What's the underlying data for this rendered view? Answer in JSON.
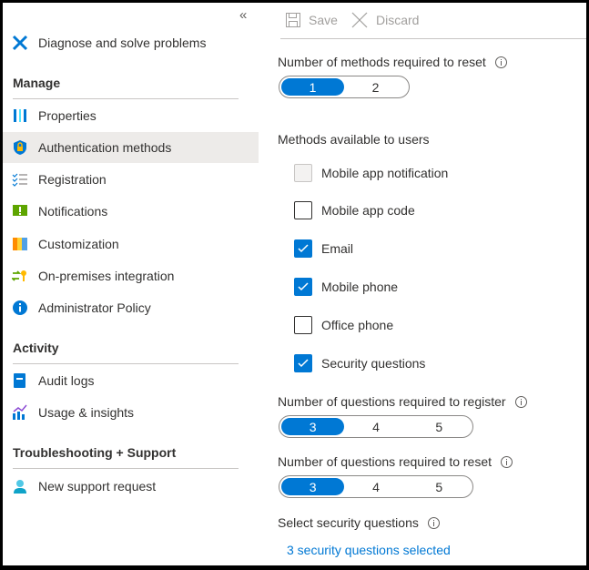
{
  "sidebar": {
    "collapse_icon": "double-chevron-left",
    "diagnose": "Diagnose and solve problems",
    "sections": {
      "manage": "Manage",
      "activity": "Activity",
      "troubleshooting": "Troubleshooting + Support"
    },
    "items": [
      {
        "label": "Properties",
        "icon": "properties-icon"
      },
      {
        "label": "Authentication methods",
        "icon": "shield-lock-icon"
      },
      {
        "label": "Registration",
        "icon": "checklist-icon"
      },
      {
        "label": "Notifications",
        "icon": "notification-icon"
      },
      {
        "label": "Customization",
        "icon": "customization-icon"
      },
      {
        "label": "On-premises integration",
        "icon": "sync-key-icon"
      },
      {
        "label": "Administrator Policy",
        "icon": "info-icon"
      },
      {
        "label": "Audit logs",
        "icon": "book-icon"
      },
      {
        "label": "Usage & insights",
        "icon": "chart-icon"
      },
      {
        "label": "New support request",
        "icon": "support-person-icon"
      }
    ]
  },
  "toolbar": {
    "save": "Save",
    "discard": "Discard"
  },
  "main": {
    "methods_reset_label": "Number of methods required to reset",
    "methods_reset_options": [
      "1",
      "2"
    ],
    "methods_available_label": "Methods available to users",
    "methods": [
      {
        "label": "Mobile app notification",
        "state": "disabled"
      },
      {
        "label": "Mobile app code",
        "state": "unchecked"
      },
      {
        "label": "Email",
        "state": "checked"
      },
      {
        "label": "Mobile phone",
        "state": "checked"
      },
      {
        "label": "Office phone",
        "state": "unchecked"
      },
      {
        "label": "Security questions",
        "state": "checked"
      }
    ],
    "questions_register_label": "Number of questions required to register",
    "questions_register_options": [
      "3",
      "4",
      "5"
    ],
    "questions_reset_label": "Number of questions required to reset",
    "questions_reset_options": [
      "3",
      "4",
      "5"
    ],
    "select_questions_label": "Select security questions",
    "select_questions_link": "3 security questions selected"
  },
  "colors": {
    "accent": "#0078d4",
    "selected_row": "#edebe9"
  }
}
